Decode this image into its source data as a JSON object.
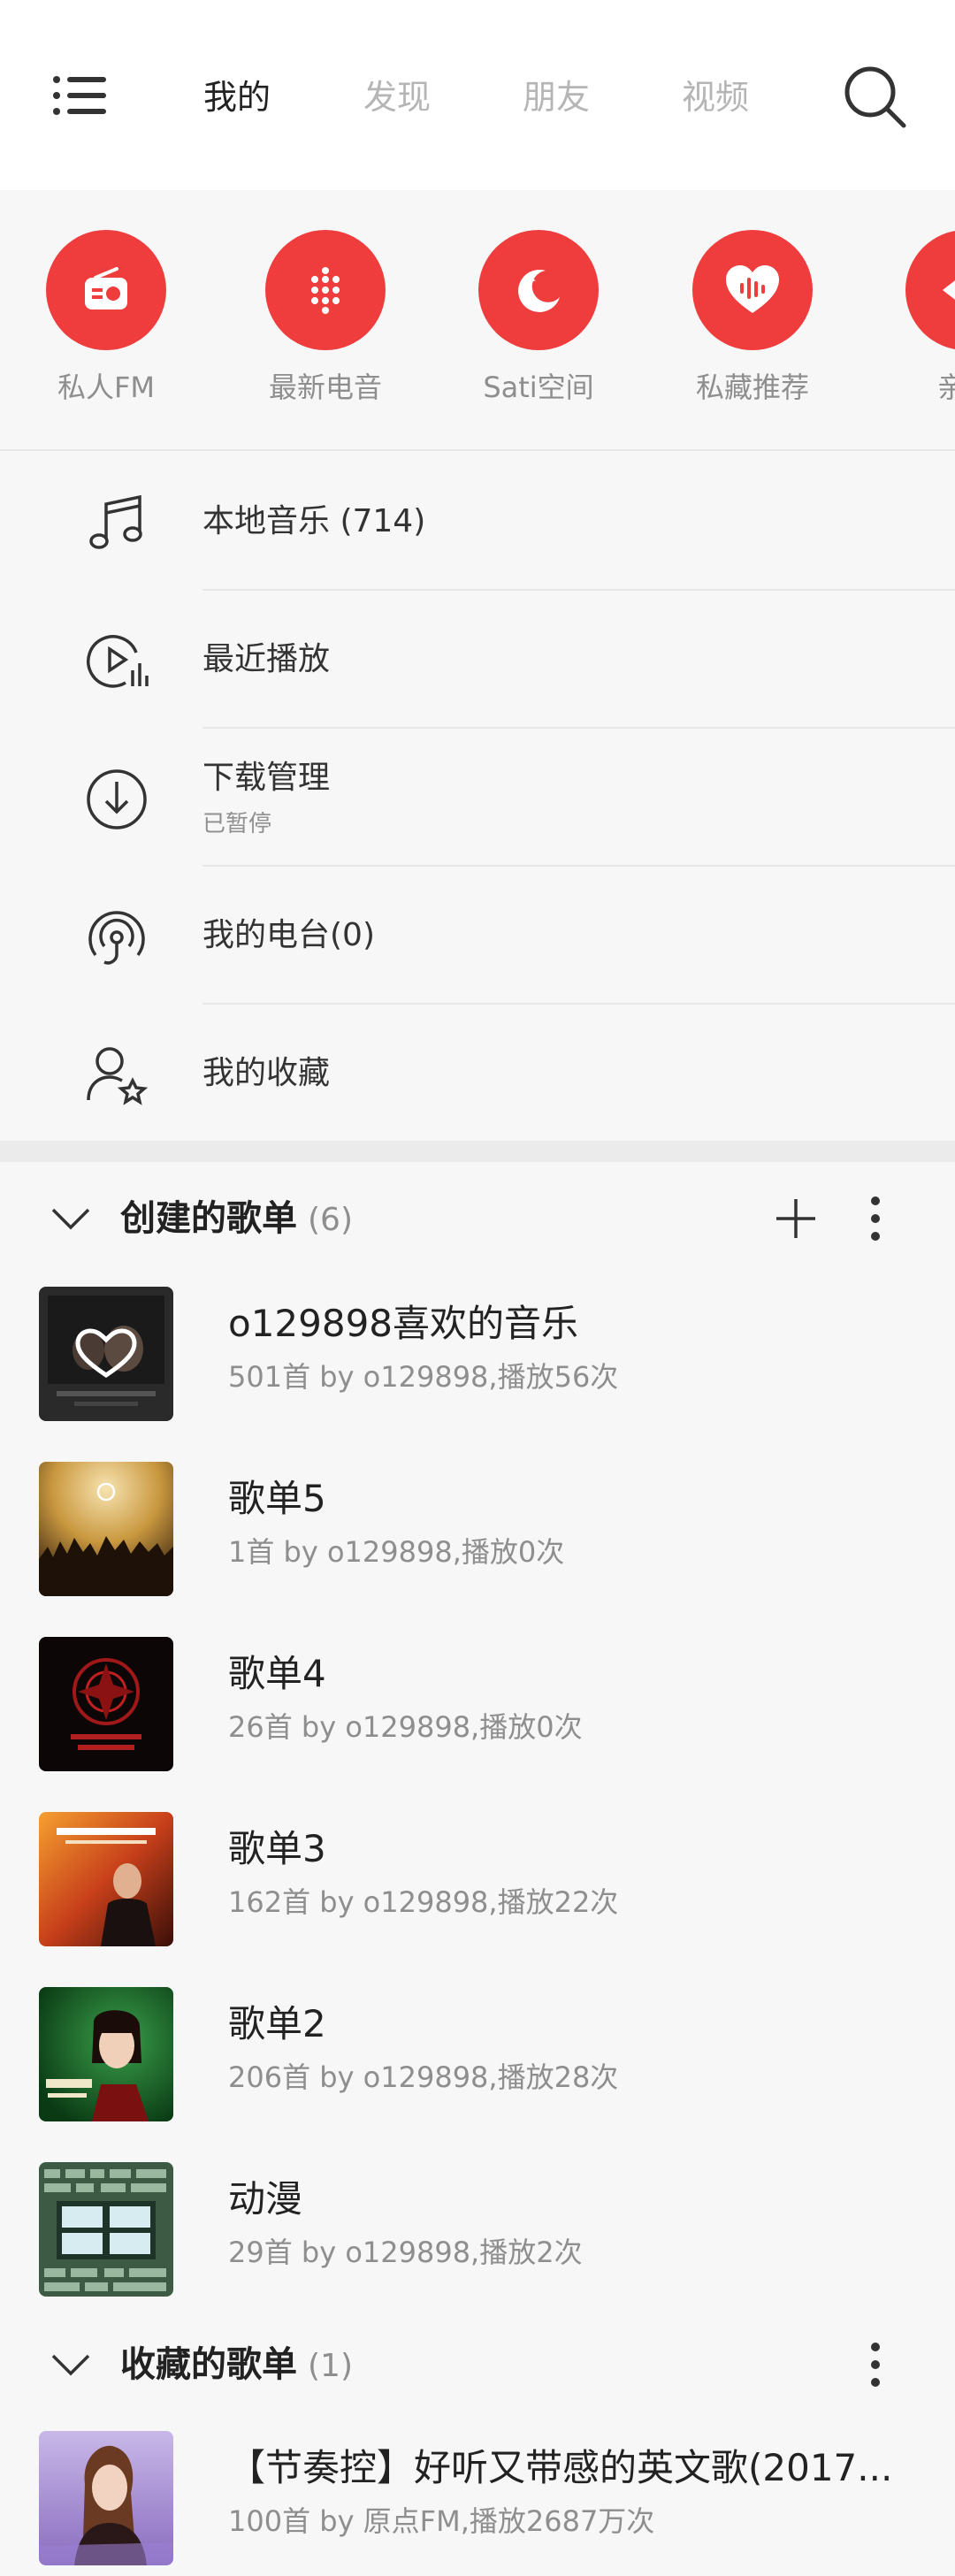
{
  "nav": {
    "tabs": [
      "我的",
      "发现",
      "朋友",
      "视频"
    ],
    "active_tab": 0
  },
  "quick_access": [
    {
      "label": "私人FM",
      "icon": "radio-icon"
    },
    {
      "label": "最新电音",
      "icon": "dots-grid-icon"
    },
    {
      "label": "Sati空间",
      "icon": "moon-icon"
    },
    {
      "label": "私藏推荐",
      "icon": "heart-wave-icon"
    },
    {
      "label": "亲子",
      "icon": "child-icon"
    }
  ],
  "menu": [
    {
      "label": "本地音乐 (714)",
      "sub": "",
      "icon": "music-note-icon"
    },
    {
      "label": "最近播放",
      "sub": "",
      "icon": "recent-play-icon"
    },
    {
      "label": "下载管理",
      "sub": "已暂停",
      "icon": "download-icon"
    },
    {
      "label": "我的电台(0)",
      "sub": "",
      "icon": "radio-station-icon"
    },
    {
      "label": "我的收藏",
      "sub": "",
      "icon": "favorite-user-icon"
    }
  ],
  "created_playlists": {
    "title": "创建的歌单",
    "count": "(6)",
    "items": [
      {
        "name": "o129898喜欢的音乐",
        "info": "501首 by o129898,播放56次"
      },
      {
        "name": "歌单5",
        "info": "1首 by o129898,播放0次"
      },
      {
        "name": "歌单4",
        "info": "26首 by o129898,播放0次"
      },
      {
        "name": "歌单3",
        "info": "162首 by o129898,播放22次"
      },
      {
        "name": "歌单2",
        "info": "206首 by o129898,播放28次"
      },
      {
        "name": "动漫",
        "info": "29首 by o129898,播放2次"
      }
    ]
  },
  "collected_playlists": {
    "title": "收藏的歌单",
    "count": "(1)",
    "items": [
      {
        "name": "【节奏控】好听又带感的英文歌(2017...",
        "info": "100首 by 原点FM,播放2687万次"
      }
    ]
  },
  "colors": {
    "accent": "#ef3d3d"
  }
}
